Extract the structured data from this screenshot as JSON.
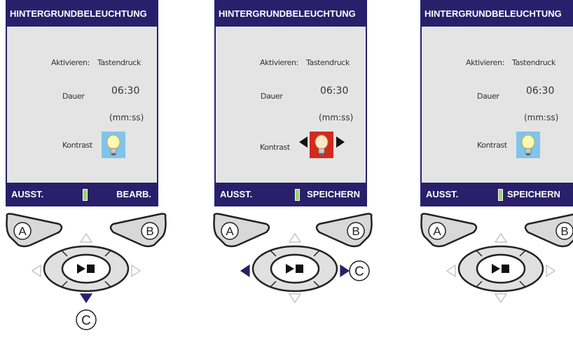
{
  "panels": [
    {
      "title": "HINTERGRUNDBELEUCHTUNG",
      "rows": {
        "aktivieren_label": "Aktivieren:",
        "aktivieren_value": "Tastendruck",
        "dauer_label": "Dauer",
        "dauer_value": "06:30",
        "dauer_unit": "(mm:ss)",
        "kontrast_label": "Kontrast"
      },
      "softkeys": {
        "left": "AUSST.",
        "right": "BEARB."
      },
      "buttons": {
        "a": "A",
        "b": "B",
        "c": "C"
      },
      "highlight": "down"
    },
    {
      "title": "HINTERGRUNDBELEUCHTUNG",
      "rows": {
        "aktivieren_label": "Aktivieren:",
        "aktivieren_value": "Tastendruck",
        "dauer_label": "Dauer",
        "dauer_value": "06:30",
        "dauer_unit": "(mm:ss)",
        "kontrast_label": "Kontrast"
      },
      "softkeys": {
        "left": "AUSST.",
        "right": "SPEICHERN"
      },
      "buttons": {
        "a": "A",
        "b": "B",
        "c": "C"
      },
      "highlight": "left-right"
    },
    {
      "title": "HINTERGRUNDBELEUCHTUNG",
      "rows": {
        "aktivieren_label": "Aktivieren:",
        "aktivieren_value": "Tastendruck",
        "dauer_label": "Dauer",
        "dauer_value": "06:30",
        "dauer_unit": "(mm:ss)",
        "kontrast_label": "Kontrast"
      },
      "softkeys": {
        "left": "AUSST.",
        "right": "SPEICHERN"
      },
      "buttons": {
        "a": "A",
        "b": "B"
      },
      "highlight": "none"
    }
  ],
  "colors": {
    "titlebar": "#2a1f6b",
    "screen_bg": "#e4e4e4",
    "bulb_blue": "#7fc4ea",
    "bulb_red": "#d22a1e",
    "battery": "#9ad36f",
    "arrow_active": "#2a1f6b"
  }
}
